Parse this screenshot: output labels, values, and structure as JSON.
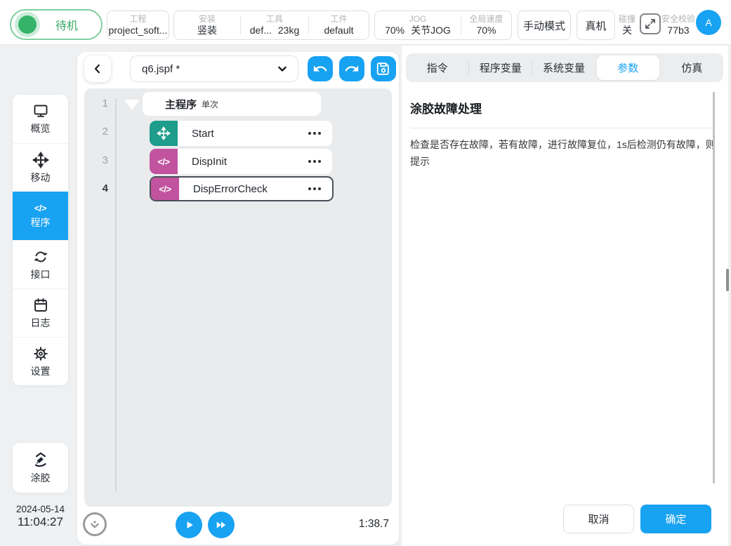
{
  "topbar": {
    "status_label": "待机",
    "project": {
      "label": "工程",
      "value": "project_soft..."
    },
    "mount": {
      "label": "安装",
      "value": "竖装"
    },
    "tool": {
      "label": "工具",
      "value": "def...",
      "weight": "23kg"
    },
    "workpiece": {
      "label": "工件",
      "value": "default"
    },
    "jog": {
      "label": "JOG",
      "percent": "70%",
      "mode": "关节JOG"
    },
    "speed": {
      "label": "全局速度",
      "value": "70%"
    },
    "manual_mode_label": "手动模式",
    "real_robot_label": "真机",
    "collision": {
      "label": "碰撞",
      "value": "关"
    },
    "safety": {
      "label": "安全校验",
      "value": "77b3"
    },
    "avatar_letter": "A"
  },
  "sidebar": {
    "items": [
      {
        "label": "概览"
      },
      {
        "label": "移动"
      },
      {
        "label": "程序"
      },
      {
        "label": "接口"
      },
      {
        "label": "日志"
      },
      {
        "label": "设置"
      }
    ],
    "active_item": "程序",
    "plugin_label": "涂胶",
    "date": "2024-05-14",
    "time": "11:04:27"
  },
  "editor": {
    "file_name": "q6.jspf *",
    "lines": [
      {
        "num": "1",
        "title": "主程序",
        "mode": "单次"
      },
      {
        "num": "2",
        "label": "Start"
      },
      {
        "num": "3",
        "label": "DispInit"
      },
      {
        "num": "4",
        "label": "DispErrorCheck"
      }
    ],
    "selected_line": "4",
    "run_time": "1:38.7"
  },
  "panel": {
    "tabs": [
      {
        "label": "指令"
      },
      {
        "label": "程序变量"
      },
      {
        "label": "系统变量"
      },
      {
        "label": "参数"
      },
      {
        "label": "仿真"
      }
    ],
    "active_tab": "参数",
    "title": "涂胶故障处理",
    "description": "检查是否存在故障，若有故障，进行故障复位，1s后检测仍有故障，则提示",
    "cancel_label": "取消",
    "confirm_label": "确定"
  },
  "colors": {
    "accent_blue": "#18a2f2",
    "status_green": "#35b469",
    "cmd_teal": "#1e9c8c",
    "cmd_magenta": "#c1539f"
  }
}
